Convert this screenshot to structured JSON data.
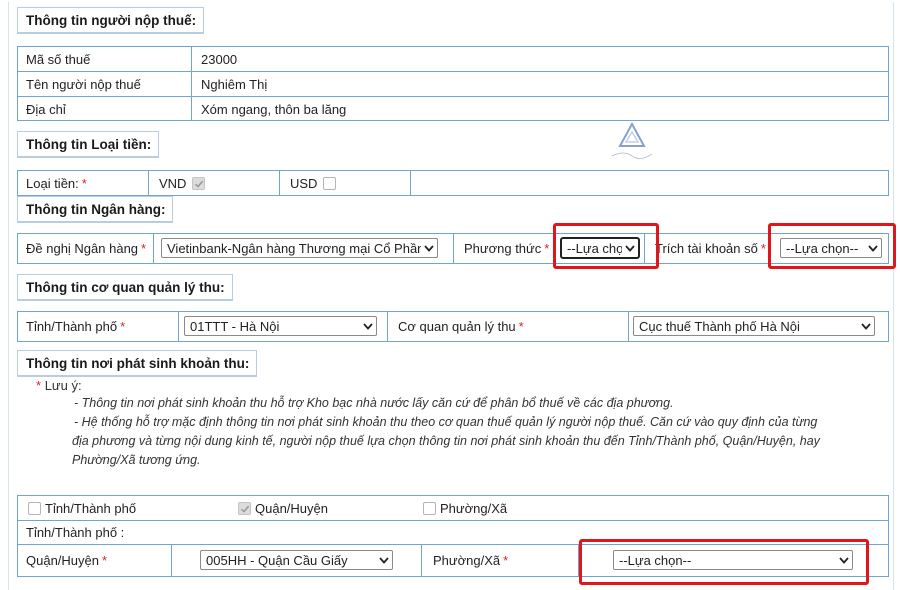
{
  "taxpayer": {
    "title": "Thông tin người nộp thuế:",
    "rows": [
      {
        "label": "Mã số thuế",
        "value": "23000"
      },
      {
        "label": "Tên người nộp thuế",
        "value": "Nghiêm Thị"
      },
      {
        "label": "Địa chỉ",
        "value": "Xóm ngang, thôn ba lăng"
      }
    ]
  },
  "currency": {
    "title": "Thông tin Loại tiền:",
    "label": "Loại tiền:",
    "vnd_label": "VND",
    "vnd_checked": true,
    "usd_label": "USD",
    "usd_checked": false
  },
  "bank": {
    "title": "Thông tin Ngân hàng:",
    "bank_label": "Đề nghị Ngân hàng",
    "bank_value": "Vietinbank-Ngân hàng Thương mại Cổ Phần",
    "method_label": "Phương thức",
    "method_value": "--Lựa chọ",
    "account_label": "Trích tài khoản số",
    "account_value": "--Lựa chọn--"
  },
  "agency": {
    "title": "Thông tin cơ quan quản lý thu:",
    "province_label": "Tỉnh/Thành phố",
    "province_value": "01TTT - Hà Nội",
    "agency_label": "Cơ quan quản lý thu",
    "agency_value": "Cục thuế Thành phố Hà Nội"
  },
  "origin": {
    "title": "Thông tin nơi phát sinh khoản thu:",
    "note_marker": "*",
    "note_label": "Lưu ý:",
    "note_line1": "- Thông tin nơi phát sinh khoản thu hỗ trợ Kho bạc nhà nước lấy căn cứ để phân bổ thuế về các địa phương.",
    "note_line2": "- Hệ thống hỗ trợ mặc định thông tin nơi phát sinh khoản thu theo cơ quan thuế quản lý người nộp thuế. Căn cứ vào quy định của từng",
    "note_line3": "địa phương và từng nội dung kinh tế, người nộp thuế lựa chọn thông tin nơi phát sinh khoản thu đến Tỉnh/Thành phố, Quận/Huyện, hay",
    "note_line4": "Phường/Xã tương ứng.",
    "opt_province_label": "Tỉnh/Thành phố",
    "opt_province_checked": false,
    "opt_district_label": "Quận/Huyện",
    "opt_district_checked": true,
    "opt_ward_label": "Phường/Xã",
    "opt_ward_checked": false,
    "province_row_label": "Tỉnh/Thành phố :",
    "district_label": "Quận/Huyện",
    "district_value": "005HH - Quận Cầu Giấy",
    "ward_label": "Phường/Xã",
    "ward_value": "--Lựa chọn--"
  },
  "required_marker": "*",
  "colors": {
    "grid_border": "#6fa5d0",
    "highlight": "#e0161b",
    "required": "#dd2222"
  }
}
